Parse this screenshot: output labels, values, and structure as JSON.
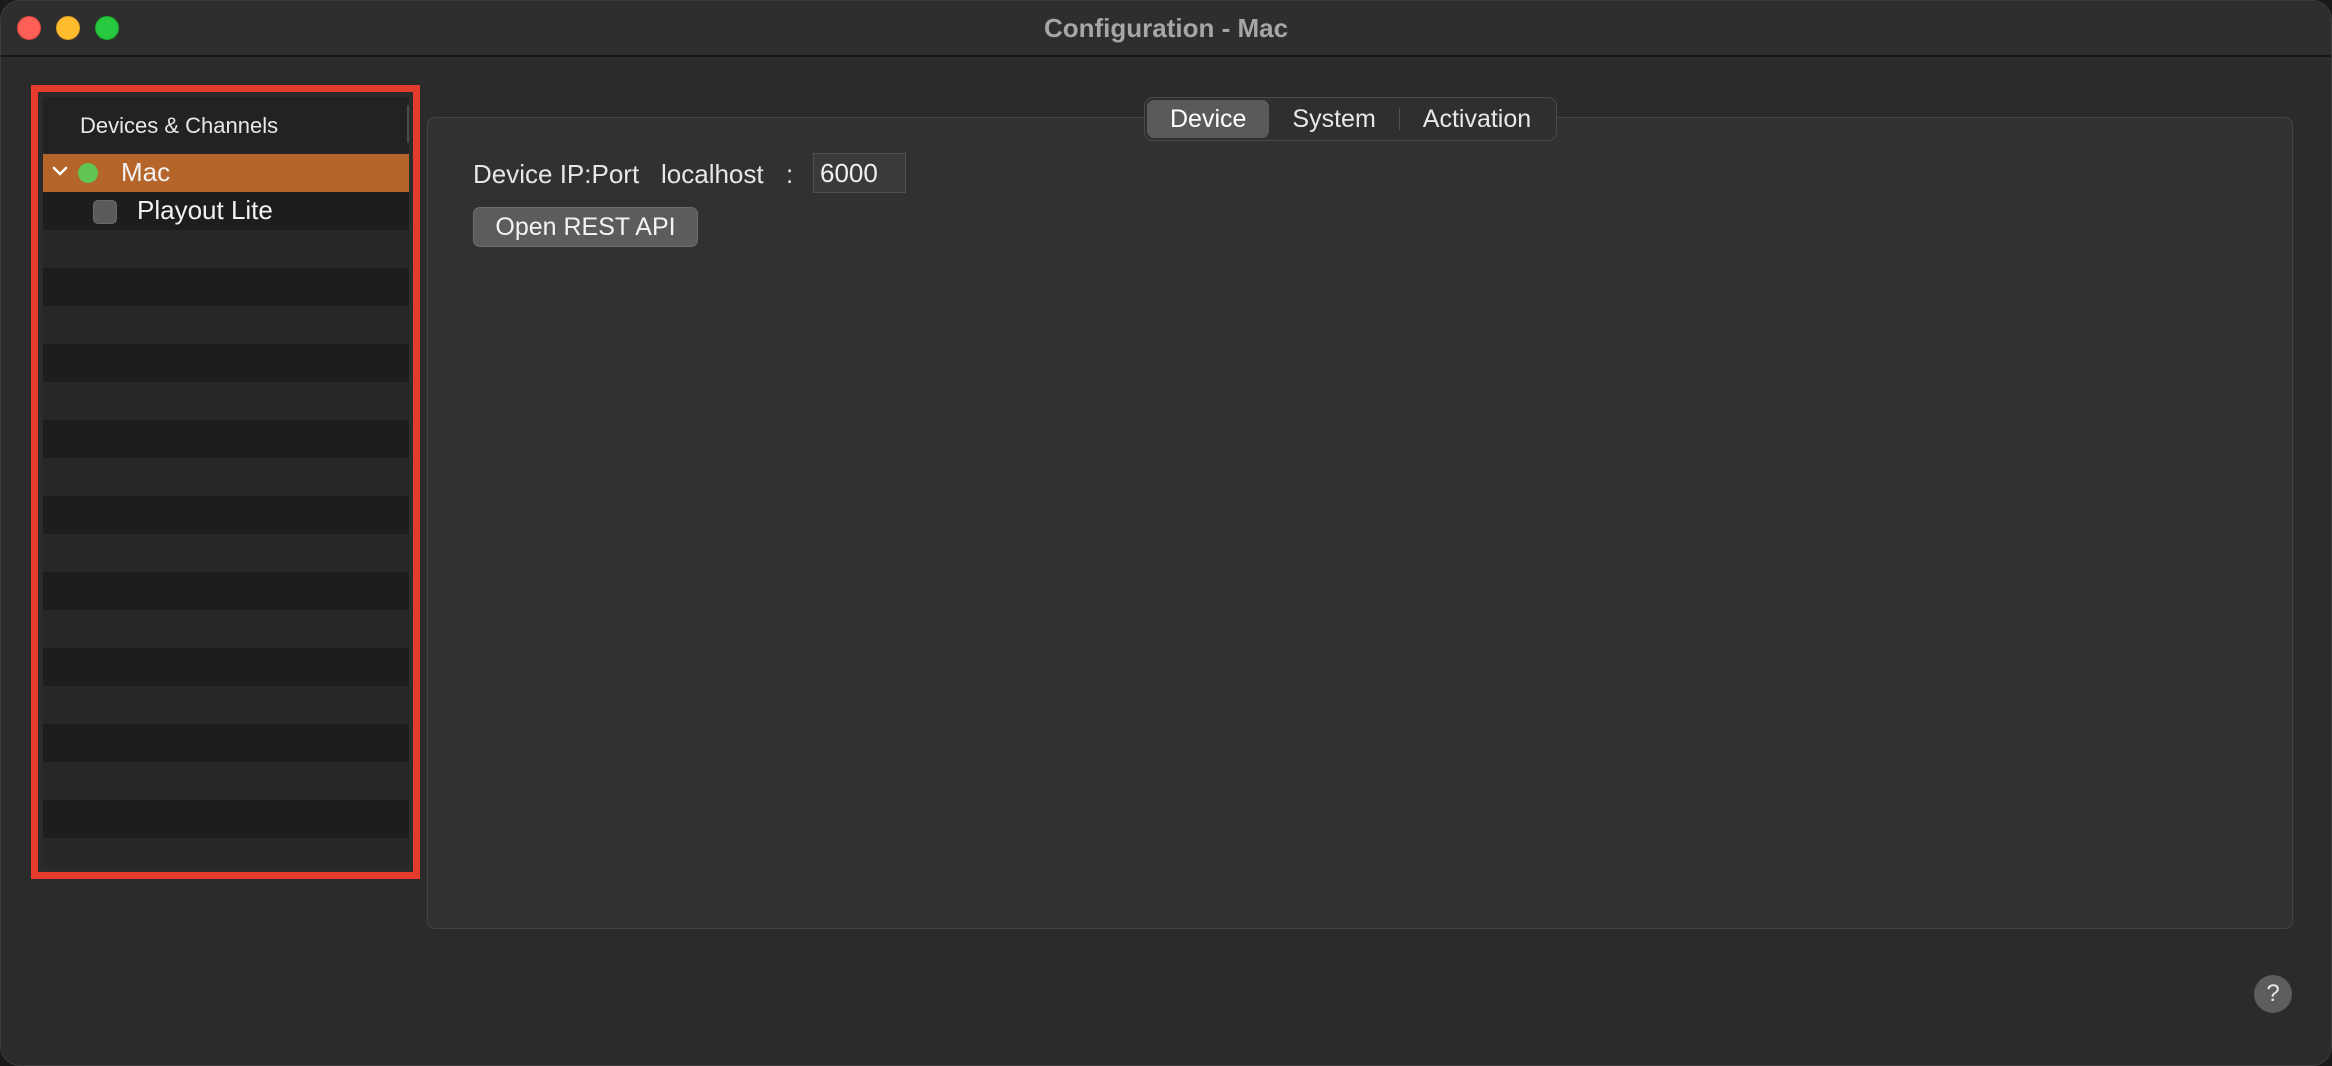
{
  "window": {
    "title": "Configuration - Mac"
  },
  "sidebar": {
    "header": "Devices & Channels",
    "device": {
      "label": "Mac",
      "status": "online",
      "status_color": "#61c554",
      "expanded": true,
      "selected": true
    },
    "channels": [
      {
        "label": "Playout Lite",
        "checked": false
      }
    ]
  },
  "tabs": [
    {
      "label": "Device",
      "active": true
    },
    {
      "label": "System",
      "active": false
    },
    {
      "label": "Activation",
      "active": false
    }
  ],
  "device_panel": {
    "ip_label": "Device IP:Port",
    "host": "localhost",
    "separator": ":",
    "port": "6000",
    "rest_button": "Open REST API"
  },
  "help": {
    "label": "?"
  },
  "colors": {
    "selection": "#b5652a",
    "highlight_border": "#e53b2c",
    "status_online": "#61c554"
  }
}
